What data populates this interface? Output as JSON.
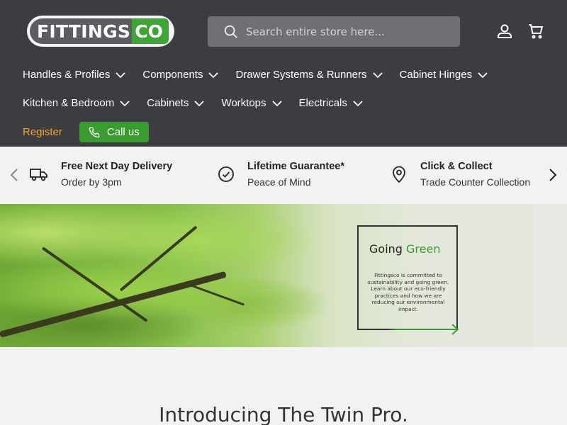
{
  "logo": {
    "part1": "FITTINGS",
    "part2": "CO"
  },
  "search": {
    "placeholder": "Search entire store here..."
  },
  "header_icons": [
    "account-icon",
    "cart-icon"
  ],
  "nav": {
    "row1": [
      "Handles & Profiles",
      "Components",
      "Drawer Systems & Runners",
      "Cabinet Hinges"
    ],
    "row2": [
      "Kitchen & Bedroom",
      "Cabinets",
      "Worktops",
      "Electricals"
    ],
    "register": "Register",
    "call_us": "Call us"
  },
  "usp": [
    {
      "icon": "truck-icon",
      "title": "Free Next Day Delivery",
      "sub": "Order by 3pm"
    },
    {
      "icon": "check-circle-icon",
      "title": "Lifetime Guarantee*",
      "sub": "Peace of Mind"
    },
    {
      "icon": "map-pin-icon",
      "title": "Click & Collect",
      "sub": "Trade Counter Collection"
    }
  ],
  "hero": {
    "heading_1": "Going",
    "heading_2": "Green",
    "text": "Fittingsco is committed to sustainability and going green. Learn about our eco-friendly practices and how we are reducing our environmental impact."
  },
  "intro": {
    "heading": "Introducing The Twin Pro."
  },
  "colors": {
    "header_bg": "#3c3d40",
    "accent_green": "#3a9c2f",
    "register_orange": "#f4a62a"
  }
}
